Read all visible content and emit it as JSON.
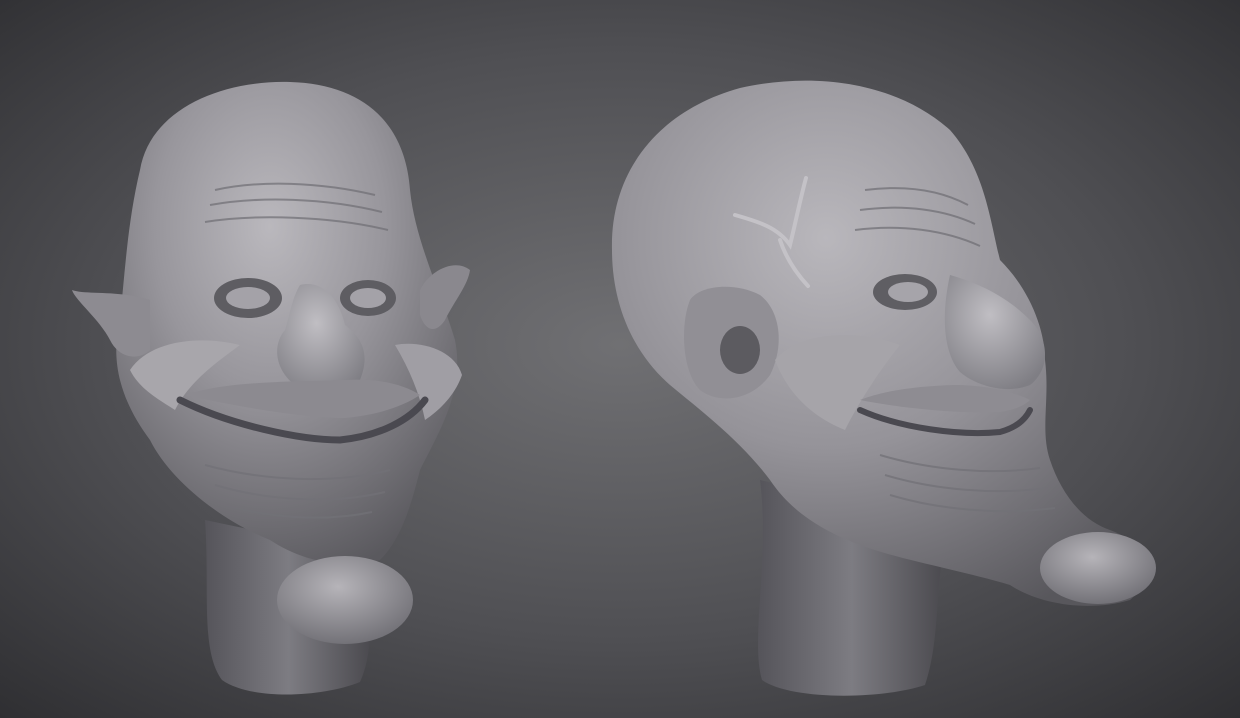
{
  "scene": {
    "subject": "sculpt-render",
    "views": [
      {
        "view": "front-three-quarter"
      },
      {
        "view": "side-three-quarter"
      }
    ]
  },
  "colors": {
    "background_center": "#6f6f72",
    "background_edge": "#2e2e31",
    "clay_light": "#b3b1b6",
    "clay_mid": "#8e8c92",
    "clay_shadow": "#57565b",
    "clay_deep": "#3e3d42"
  }
}
